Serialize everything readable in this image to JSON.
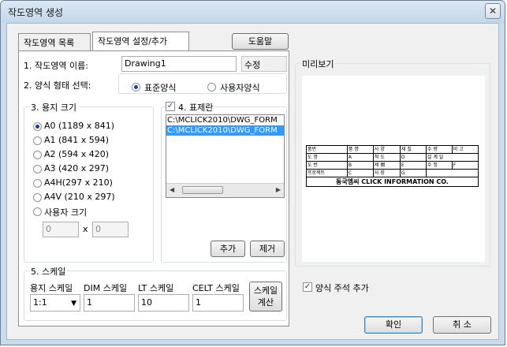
{
  "window": {
    "title": "작도영역 생성",
    "close_glyph": "✕"
  },
  "tabs": [
    {
      "label": "작도영역 목록"
    },
    {
      "label": "작도영역 설정/추가"
    }
  ],
  "help_button": "도움말",
  "area_name": {
    "label": "1. 작도영역 이름:",
    "value": "Drawing1",
    "edit_button": "수정"
  },
  "format_type": {
    "label": "2. 양식 형태 선택:",
    "standard": "표준양식",
    "user": "사용자양식",
    "selected": "standard"
  },
  "paper_size": {
    "label": "3. 용지 크기",
    "options": [
      {
        "label": "A0 (1189 x 841)",
        "selected": true
      },
      {
        "label": "A1 (841 x 594)",
        "selected": false
      },
      {
        "label": "A2 (594 x 420)",
        "selected": false
      },
      {
        "label": "A3 (420 x 297)",
        "selected": false
      },
      {
        "label": "A4H(297 x 210)",
        "selected": false
      },
      {
        "label": "A4V (210 x 297)",
        "selected": false
      },
      {
        "label": "사용자 크기",
        "selected": false
      }
    ],
    "custom_width": "0",
    "custom_x": "x",
    "custom_height": "0"
  },
  "title_block": {
    "label": "4. 표제란",
    "checked": true,
    "files": [
      {
        "path": "C:\\MCLICK2010\\DWG_FORM",
        "selected": false
      },
      {
        "path": "C:\\MCLICK2010\\DWG_FORM",
        "selected": true
      }
    ],
    "add_button": "추가",
    "remove_button": "제거"
  },
  "scale": {
    "label": "5. 스케일",
    "paper_scale_label": "용지 스케일",
    "paper_scale_value": "1:1",
    "dim_scale_label": "DIM 스케일",
    "dim_scale_value": "1",
    "lt_scale_label": "LT 스케일",
    "lt_scale_value": "10",
    "celt_scale_label": "CELT 스케일",
    "celt_scale_value": "1",
    "calc_button_line1": "스케일",
    "calc_button_line2": "계산"
  },
  "preview": {
    "label": "미리보기",
    "title_block": {
      "row1": [
        "품번",
        "품 명",
        "사 양",
        "재 질",
        "수 량",
        "비 고"
      ],
      "row2": [
        "도 명",
        "A",
        "척 도",
        "D",
        "설 계 일"
      ],
      "row3": [
        "도 번",
        "B",
        "제 图",
        "E",
        "수 정",
        "F"
      ],
      "row4": [
        "프로젝트",
        "C",
        "사 장",
        "G"
      ],
      "footer": "동국엠씨 CLICK INFORMATION CO."
    }
  },
  "annotation_checkbox": {
    "label": "양식 주석 추가",
    "checked": true
  },
  "ok_button": "확인",
  "cancel_button": "취 소",
  "colors": {
    "selection": "#3399ff",
    "title_bar": "#c9dced",
    "radio_dot": "#1b3f8f"
  },
  "icons": {
    "close": "close-icon",
    "dropdown": "chevron-down-icon",
    "check": "check-icon"
  }
}
